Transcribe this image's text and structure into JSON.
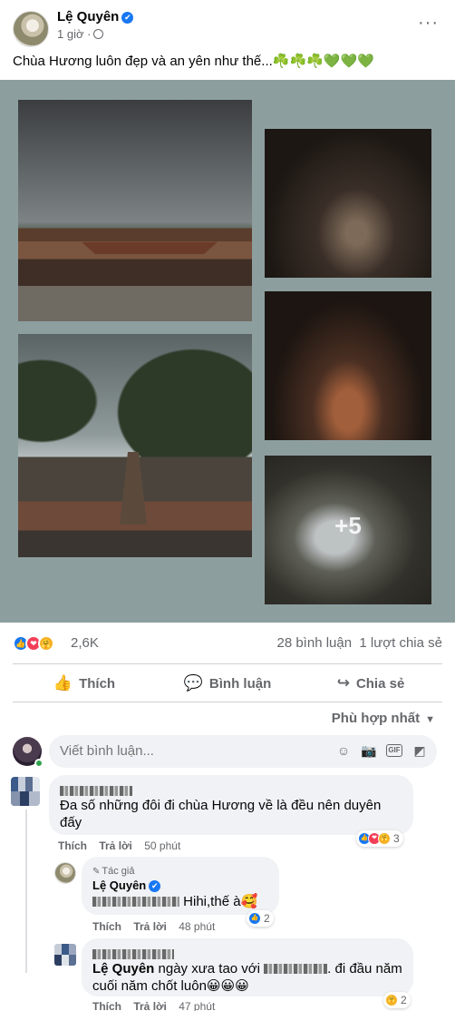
{
  "post": {
    "author": "Lệ Quyên",
    "verified_glyph": "✔",
    "time": "1 giờ",
    "more_glyph": "···",
    "text": "Chùa Hương luôn đẹp và an yên như thế...☘️☘️☘️💚💚💚",
    "more_photos": "+5"
  },
  "reactions": {
    "icons": {
      "like": "👍",
      "love": "❤",
      "care": "🤗"
    },
    "count": "2,6K",
    "comments": "28 bình luận",
    "shares": "1 lượt chia sẻ"
  },
  "actions": {
    "like": {
      "icon": "👍",
      "label": "Thích"
    },
    "comment": {
      "icon": "💬",
      "label": "Bình luận"
    },
    "share": {
      "icon": "↪",
      "label": "Chia sẻ"
    }
  },
  "sort": {
    "label": "Phù hợp nhất",
    "caret": "▼"
  },
  "composer": {
    "placeholder": "Viết bình luận...",
    "icons": {
      "emoji": "☺",
      "camera": "📷",
      "gif": "GIF",
      "sticker": "◩"
    }
  },
  "comments": [
    {
      "text": "Đa số những đôi đi chùa Hương về là đều nên duyên đấy",
      "like": "Thích",
      "reply": "Trả lời",
      "time": "50 phút",
      "reaction_count": "3"
    },
    {
      "author_tag": "Tác giả",
      "author_pen": "✎",
      "author": "Lệ Quyên",
      "text": "Hihi,thế à🥰",
      "like": "Thích",
      "reply": "Trả lời",
      "time": "48 phút",
      "reaction_count": "2"
    },
    {
      "mention": "Lệ Quyên",
      "text_a": " ngày xưa tao với",
      "text_b": ". đi đầu năm cuối năm chốt luôn😀😀😀",
      "like": "Thích",
      "reply": "Trả lời",
      "time": "47 phút",
      "reaction_count": "2"
    }
  ]
}
